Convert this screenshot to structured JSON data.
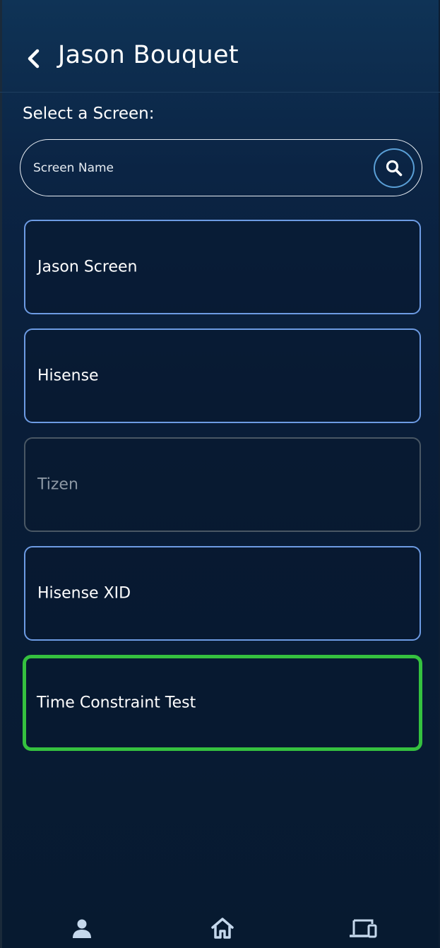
{
  "header": {
    "title": "Jason Bouquet",
    "back_icon": "chevron-left-icon"
  },
  "content": {
    "section_label": "Select a Screen:",
    "search": {
      "placeholder": "Screen Name",
      "value": "",
      "icon": "search-icon"
    },
    "screens": [
      {
        "name": "Jason Screen",
        "state": "default"
      },
      {
        "name": "Hisense",
        "state": "default"
      },
      {
        "name": "Tizen",
        "state": "disabled"
      },
      {
        "name": "Hisense XID",
        "state": "default"
      },
      {
        "name": "Time Constraint Test",
        "state": "selected"
      }
    ]
  },
  "bottom_nav": {
    "items": [
      {
        "icon": "user-icon"
      },
      {
        "icon": "home-icon"
      },
      {
        "icon": "devices-icon"
      }
    ]
  },
  "colors": {
    "background_top": "#0f3356",
    "background_bottom": "#071a30",
    "card_border": "#6d9be3",
    "card_border_disabled": "#495764",
    "selected_border": "#35c13f",
    "search_button_ring": "#5a9fd6",
    "icon_color": "#c5d8ec"
  }
}
